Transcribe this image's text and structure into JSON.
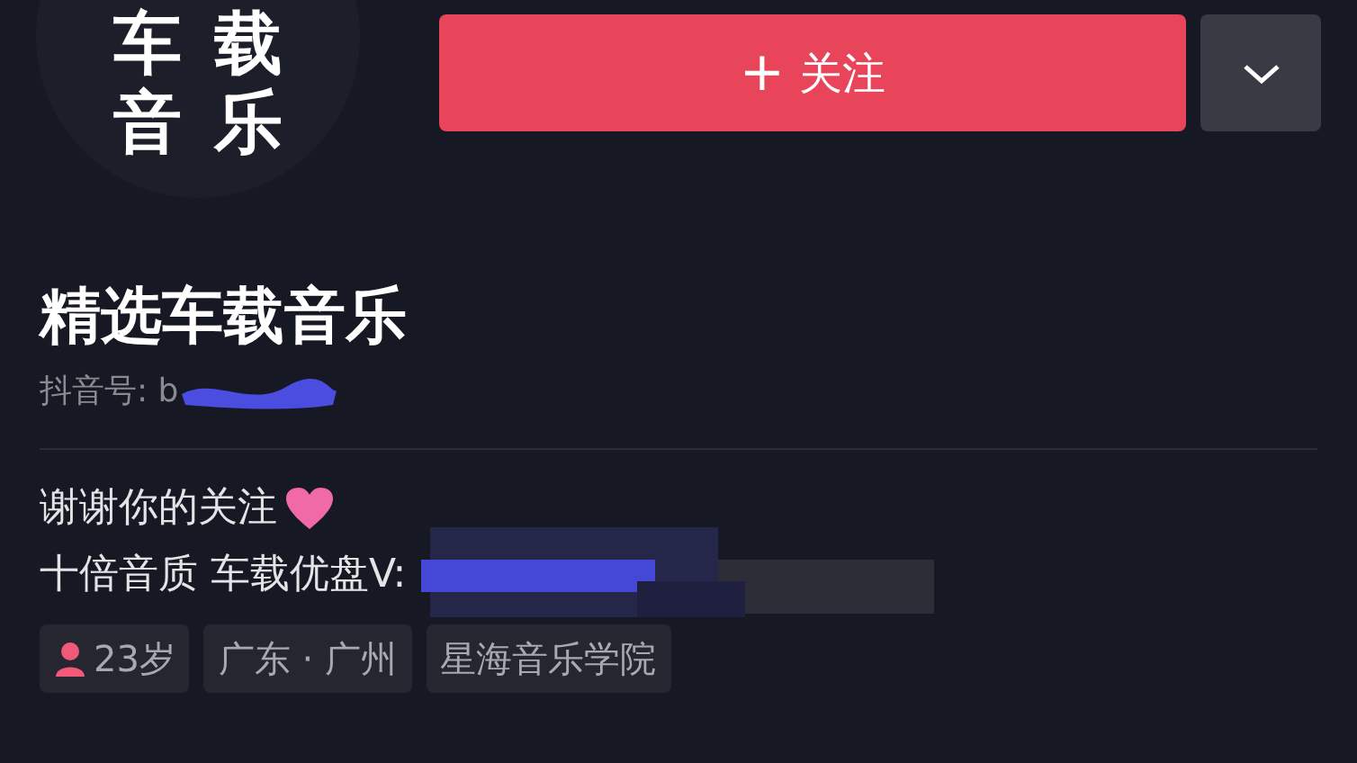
{
  "avatar": {
    "lines": [
      "车载",
      "音乐"
    ]
  },
  "follow_button": {
    "icon_text": "+",
    "label": "关注"
  },
  "profile": {
    "name": "精选车载音乐",
    "id_label": "抖音号: b"
  },
  "bio": {
    "line_1": "谢谢你的关注",
    "line_2": "十倍音质 车载优盘V:"
  },
  "tags": [
    {
      "kind": "gender",
      "text": "23岁"
    },
    {
      "kind": "plain",
      "text": "广东 · 广州"
    },
    {
      "kind": "plain",
      "text": "星海音乐学院"
    }
  ]
}
